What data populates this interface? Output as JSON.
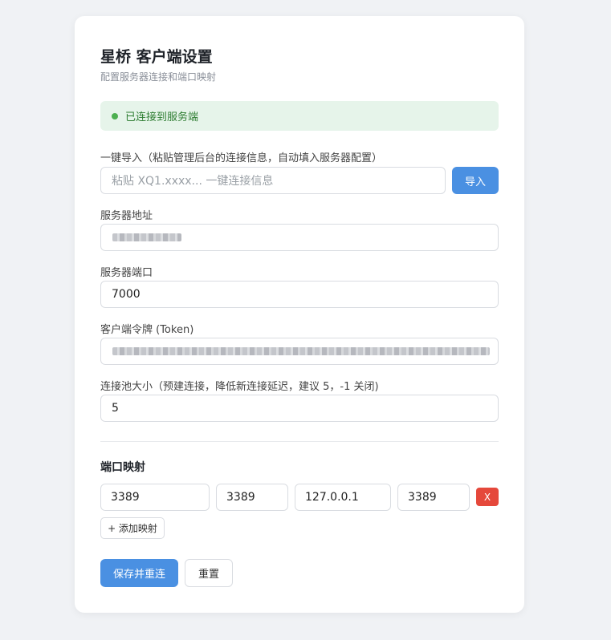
{
  "header": {
    "title": "星桥 客户端设置",
    "subtitle": "配置服务器连接和端口映射"
  },
  "status": {
    "text": "已连接到服务端",
    "color": "#4caf50"
  },
  "import": {
    "label": "一键导入（粘贴管理后台的连接信息，自动填入服务器配置）",
    "placeholder": "粘贴 XQ1.xxxx... 一键连接信息",
    "button_label": "导入"
  },
  "server_address": {
    "label": "服务器地址",
    "value": ""
  },
  "server_port": {
    "label": "服务器端口",
    "value": "7000"
  },
  "token": {
    "label": "客户端令牌 (Token)",
    "value": ""
  },
  "pool": {
    "label": "连接池大小（预建连接，降低新连接延迟，建议 5，-1 关闭)",
    "value": "5"
  },
  "port_mapping": {
    "title": "端口映射",
    "rows": [
      {
        "remote_port": "3389",
        "local_port": "3389",
        "local_ip": "127.0.0.1",
        "target_port": "3389",
        "delete_label": "X"
      }
    ],
    "add_label": "+ 添加映射"
  },
  "actions": {
    "save_label": "保存并重连",
    "reset_label": "重置"
  },
  "colors": {
    "accent": "#4a90e2",
    "danger": "#e5483b",
    "success_bg": "#e6f4ea",
    "success_text": "#2e7d32"
  }
}
